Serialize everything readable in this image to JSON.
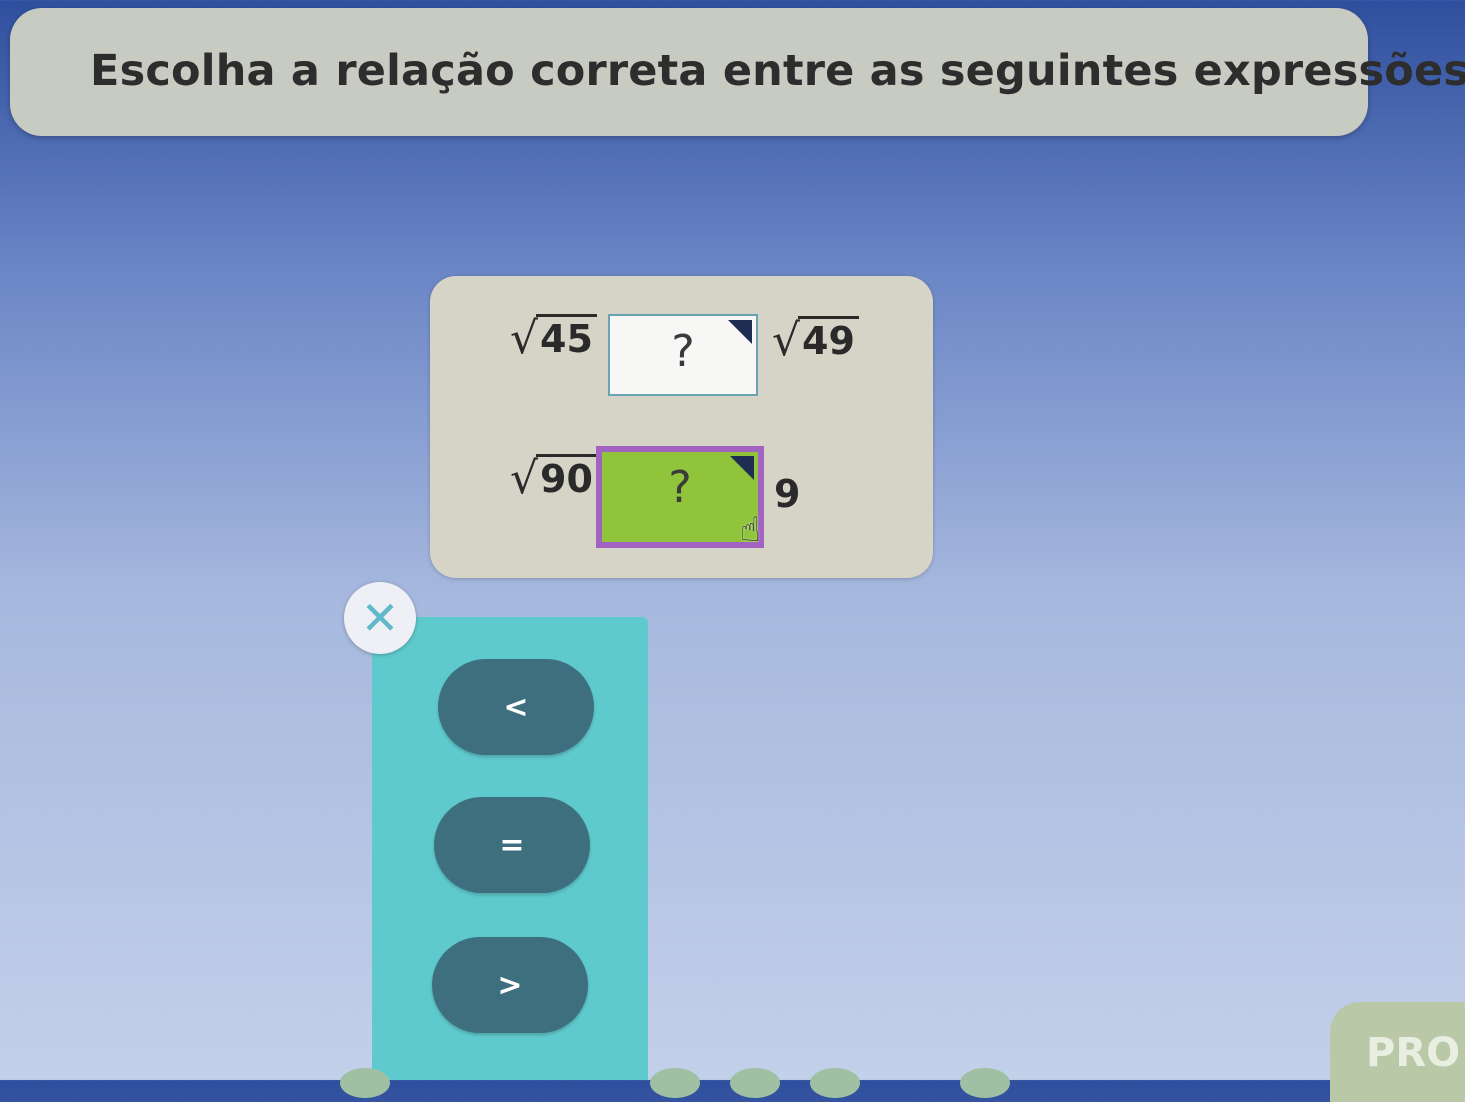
{
  "header": {
    "prompt": "Escolha a relação correta entre as seguintes expressões:"
  },
  "problems": [
    {
      "left": {
        "radicand": "45"
      },
      "relation": "?",
      "right": {
        "radicand": "49"
      }
    },
    {
      "left": {
        "radicand": "90"
      },
      "relation": "?",
      "right": {
        "value": "9"
      }
    }
  ],
  "selector": {
    "close_symbol": "✕",
    "options": [
      "<",
      "=",
      ">"
    ]
  },
  "footer": {
    "next_label": "PRO"
  },
  "colors": {
    "active_box": "#8fc43b",
    "active_border": "#a262c1",
    "panel": "#5fcacd",
    "option_button": "#3d6f7f"
  },
  "icons": {
    "close": "close-icon",
    "dropdown_corner": "dropdown-corner-icon",
    "cursor": "hand-cursor-icon"
  }
}
